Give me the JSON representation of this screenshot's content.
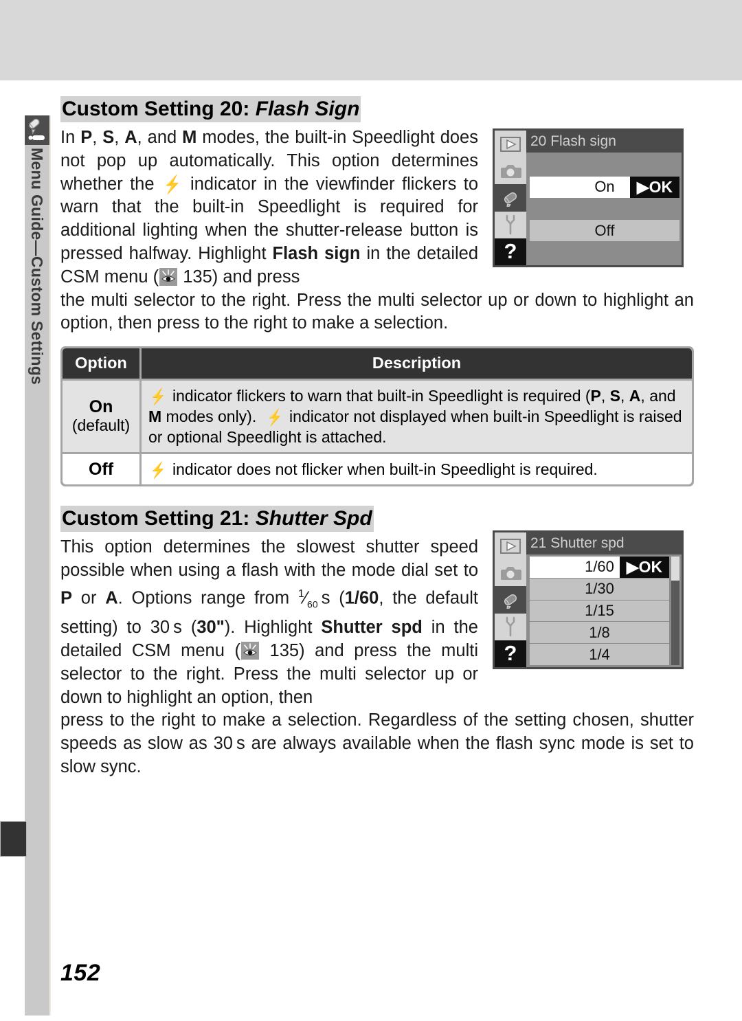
{
  "page": {
    "number": "152",
    "rail_label": "Menu Guide—Custom Settings",
    "rail_tab_icon": "pencil-icon"
  },
  "sections": [
    {
      "heading_prefix": "Custom Setting 20:",
      "heading_name": "Flash Sign",
      "body_part1": "In ",
      "body": "In P, S, A, and M modes, the built-in Speedlight does not pop up automatically.  This option determines whether the ⚡ indicator in the viewfinder flickers to warn that the built-in Speedlight is required for additional lighting when the shutter-release button is pressed halfway.  Highlight Flash sign in the detailed CSM menu (👁 135) and press the multi selector to the right.  Press the multi selector up or down to highlight an option, then press to the right to make a selection.",
      "ref_page": "135",
      "ref_icon": "eye-icon",
      "lcd": {
        "title": "20 Flash sign",
        "ok_label": "OK",
        "rows": [
          {
            "label": "",
            "state": "empty"
          },
          {
            "label": "On",
            "state": "selected"
          },
          {
            "label": "",
            "state": "empty"
          },
          {
            "label": "Off",
            "state": "alt"
          },
          {
            "label": "",
            "state": "empty"
          }
        ],
        "rail_icons": [
          "play-icon",
          "camera-icon",
          "pencil-icon",
          "wrench-icon",
          "question-icon"
        ],
        "selected_rail_index": 2,
        "has_scrollbar": false
      },
      "table": {
        "headers": [
          "Option",
          "Description"
        ],
        "rows": [
          {
            "option": "On",
            "option_sub": "(default)",
            "description": "⚡ indicator flickers to warn that built-in Speedlight is required (P, S, A, and M modes only).  ⚡ indicator not displayed when built-in Speedlight is raised or optional Speedlight is attached.",
            "shaded": true
          },
          {
            "option": "Off",
            "option_sub": "",
            "description": "⚡ indicator does not flicker when built-in Speedlight is required.",
            "shaded": false
          }
        ]
      }
    },
    {
      "heading_prefix": "Custom Setting 21:",
      "heading_name": "Shutter Spd",
      "body": "This option determines the slowest shutter speed possible when using a flash with the mode dial set to P or A.  Options range from 1/60 s (1/60, the default setting) to 30 s (30\").  Highlight Shutter spd in the detailed CSM menu (👁 135) and press the multi selector to the right.  Press the multi selector up or down to highlight an option, then press to the right to make a selection.  Regardless of the setting chosen, shutter speeds as slow as 30 s are always available when the flash sync mode is set to slow sync.",
      "ref_page": "135",
      "ref_icon": "eye-icon",
      "lcd": {
        "title": "21 Shutter spd",
        "ok_label": "OK",
        "rows": [
          {
            "label": "1/60",
            "state": "selected"
          },
          {
            "label": "1/30",
            "state": "alt"
          },
          {
            "label": "1/15",
            "state": "alt"
          },
          {
            "label": "1/8",
            "state": "alt"
          },
          {
            "label": "1/4",
            "state": "alt"
          }
        ],
        "rail_icons": [
          "play-icon",
          "camera-icon",
          "pencil-icon",
          "wrench-icon",
          "question-icon"
        ],
        "selected_rail_index": 2,
        "has_scrollbar": true
      }
    }
  ],
  "colors": {
    "top_band": "#d8d8d8",
    "rail": "#c9c9c9",
    "heading_highlight": "#d2d2d2",
    "table_header": "#333333",
    "table_shaded": "#e3e3e3",
    "lcd_body": "#8c8c8c",
    "lcd_title": "#4b4b4b"
  }
}
